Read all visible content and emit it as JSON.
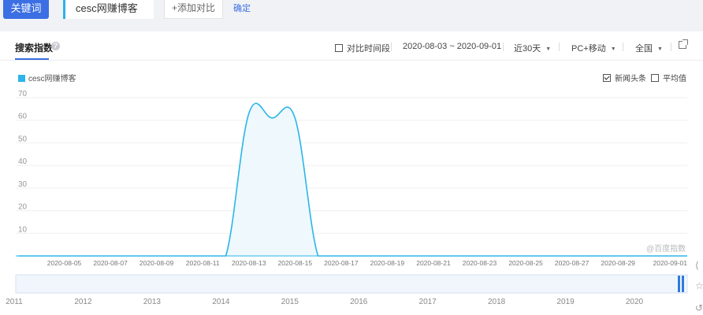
{
  "toolbar": {
    "keyword_btn": "关键词",
    "keyword": "cesc网赚博客",
    "add_compare": "+添加对比",
    "confirm": "确定"
  },
  "tab": {
    "title": "搜索指数",
    "help": "?"
  },
  "controls": {
    "compare_period": "对比时间段",
    "date_range": "2020-08-03 ~ 2020-09-01",
    "period": "近30天",
    "device": "PC+移动",
    "region": "全国"
  },
  "legend": {
    "series_name": "cesc网赚博客",
    "news_label": "新闻头条",
    "news_checked": true,
    "avg_label": "平均值",
    "avg_checked": false
  },
  "watermark": "@百度指数",
  "colors": {
    "accent": "#3b6fe3",
    "series": "#2bb5e8",
    "fill": "#eef8fd"
  },
  "chart_data": {
    "type": "area",
    "x": [
      "2020-08-03",
      "2020-08-04",
      "2020-08-05",
      "2020-08-06",
      "2020-08-07",
      "2020-08-08",
      "2020-08-09",
      "2020-08-10",
      "2020-08-11",
      "2020-08-12",
      "2020-08-13",
      "2020-08-14",
      "2020-08-15",
      "2020-08-16",
      "2020-08-17",
      "2020-08-18",
      "2020-08-19",
      "2020-08-20",
      "2020-08-21",
      "2020-08-22",
      "2020-08-23",
      "2020-08-24",
      "2020-08-25",
      "2020-08-26",
      "2020-08-27",
      "2020-08-28",
      "2020-08-29",
      "2020-08-30",
      "2020-08-31",
      "2020-09-01"
    ],
    "x_tick_labels": [
      "2020-08-05",
      "2020-08-07",
      "2020-08-09",
      "2020-08-11",
      "2020-08-13",
      "2020-08-15",
      "2020-08-17",
      "2020-08-19",
      "2020-08-21",
      "2020-08-23",
      "2020-08-25",
      "2020-08-27",
      "2020-08-29",
      "2020-09-01"
    ],
    "series": [
      {
        "name": "cesc网赚博客",
        "values": [
          0,
          0,
          0,
          0,
          0,
          0,
          0,
          0,
          0,
          0,
          63,
          61,
          61,
          0,
          0,
          0,
          0,
          0,
          0,
          0,
          0,
          0,
          0,
          0,
          0,
          0,
          0,
          0,
          0,
          0,
          0
        ]
      }
    ],
    "y_ticks": [
      10,
      20,
      30,
      40,
      50,
      60,
      70
    ],
    "ylim": [
      0,
      70
    ],
    "grid": true,
    "overview_years": [
      "2011",
      "2012",
      "2013",
      "2014",
      "2015",
      "2016",
      "2017",
      "2018",
      "2019",
      "2020"
    ]
  }
}
